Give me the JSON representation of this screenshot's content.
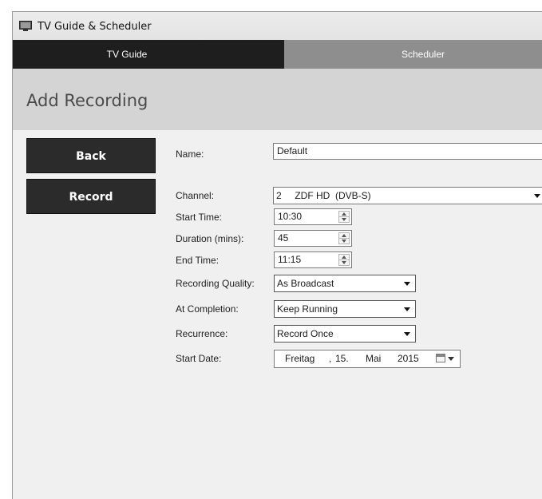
{
  "window": {
    "title": "TV Guide & Scheduler",
    "icon": "tv-icon"
  },
  "tabs": [
    {
      "label": "TV Guide",
      "active": true
    },
    {
      "label": "Scheduler",
      "active": false
    }
  ],
  "page": {
    "title": "Add Recording"
  },
  "actions": {
    "back_label": "Back",
    "record_label": "Record"
  },
  "form": {
    "name": {
      "label": "Name:",
      "value": "Default"
    },
    "channel": {
      "label": "Channel:",
      "value": "2     ZDF HD  (DVB-S)"
    },
    "start_time": {
      "label": "Start Time:",
      "value": "10:30"
    },
    "duration": {
      "label": "Duration (mins):",
      "value": "45"
    },
    "end_time": {
      "label": "End Time:",
      "value": "11:15"
    },
    "quality": {
      "label": "Recording Quality:",
      "value": "As Broadcast"
    },
    "completion": {
      "label": "At Completion:",
      "value": "Keep Running"
    },
    "recurrence": {
      "label": "Recurrence:",
      "value": "Record Once"
    },
    "start_date": {
      "label": "Start Date:",
      "weekday": "Freitag",
      "sep1": ",",
      "day": "15.",
      "month": "Mai",
      "year": "2015"
    }
  },
  "colors": {
    "tab_active": "#1e1e1e",
    "tab_inactive": "#8e8e8e",
    "button": "#2b2b2b",
    "header": "#d4d4d4"
  }
}
